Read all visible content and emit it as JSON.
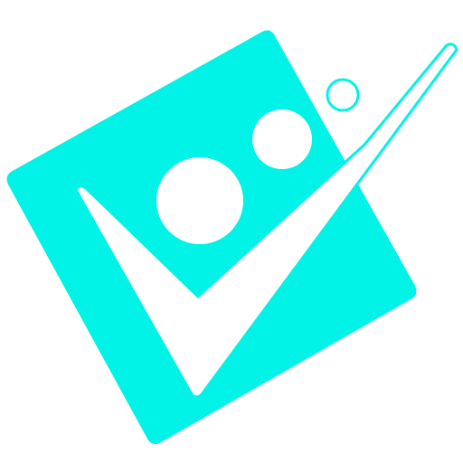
{
  "logo": {
    "description_icon": "checkmark-bubbles-logo-icon",
    "colors": {
      "primary": "#00F3E6",
      "background": "#FFFFFF"
    }
  }
}
